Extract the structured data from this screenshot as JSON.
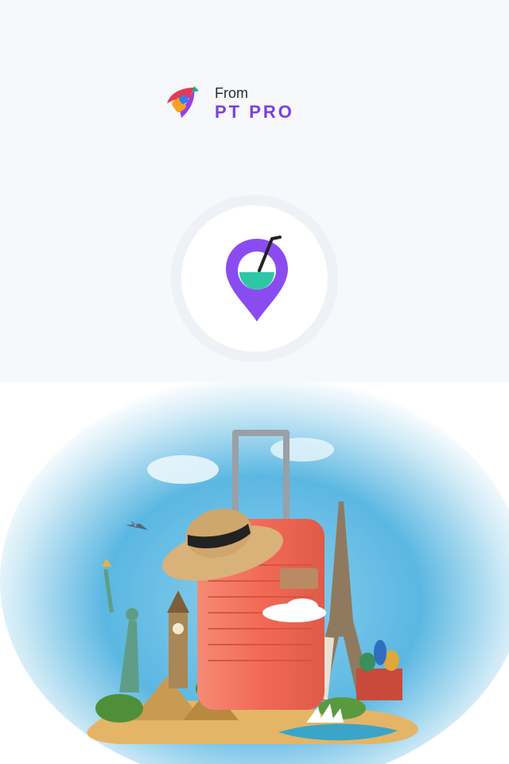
{
  "brand": {
    "from_label": "From",
    "name": "PT PRO",
    "logo_icon": "rocket-logo-icon",
    "accent": "#7b3fe4"
  },
  "app_icon": {
    "icon": "coconut-location-pin-icon",
    "pin_color": "#8a4cf0",
    "drink_color": "#2ec7a6"
  },
  "hero": {
    "illustration": "travel-suitcase-landmarks-illustration",
    "suitcase_color": "#f26a56"
  }
}
